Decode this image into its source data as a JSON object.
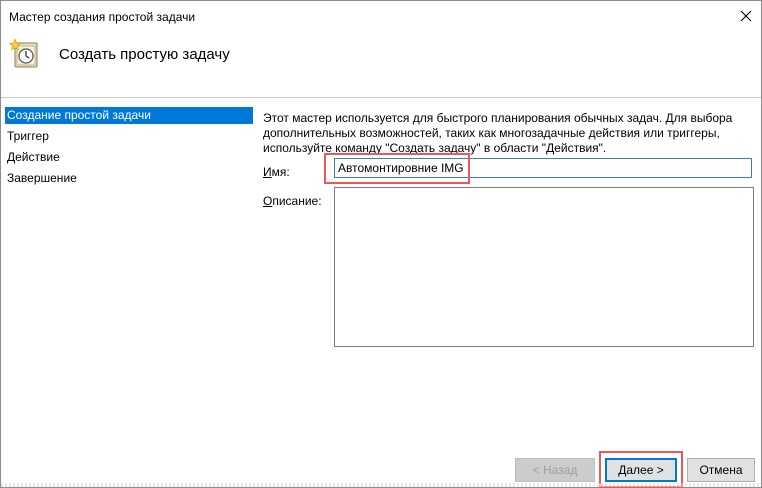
{
  "window": {
    "title": "Мастер создания простой задачи"
  },
  "header": {
    "title": "Создать простую задачу",
    "icon": "task-clock-icon"
  },
  "sidebar": {
    "items": [
      {
        "label": "Создание простой задачи",
        "active": true
      },
      {
        "label": "Триггер",
        "active": false
      },
      {
        "label": "Действие",
        "active": false
      },
      {
        "label": "Завершение",
        "active": false
      }
    ]
  },
  "main": {
    "description": "Этот мастер используется для быстрого планирования обычных задач.  Для выбора дополнительных возможностей, таких как многозадачные действия или триггеры, используйте команду \"Создать задачу\" в области \"Действия\".",
    "name_label_accel": "И",
    "name_label_rest": "мя:",
    "name_value": "Автомонтировние IMG",
    "desc_label_accel": "О",
    "desc_label_rest": "писание:",
    "desc_value": ""
  },
  "buttons": {
    "back": "< Назад",
    "next": "Далее >",
    "cancel": "Отмена"
  },
  "colors": {
    "accent": "#0078d7",
    "highlight": "#e8595a"
  }
}
